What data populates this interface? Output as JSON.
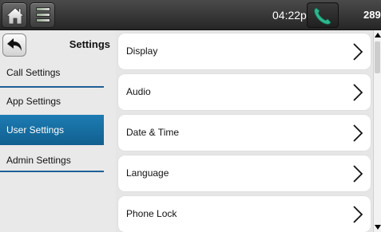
{
  "status_bar": {
    "time": "04:22pm",
    "extension": "289",
    "icons": [
      "home-icon",
      "menu-icon",
      "phone-icon"
    ]
  },
  "sidebar": {
    "title": "Settings",
    "back_icon": "back-arrow-icon",
    "items": [
      {
        "label": "Call Settings",
        "selected": false
      },
      {
        "label": "App Settings",
        "selected": false
      },
      {
        "label": "User Settings",
        "selected": true
      },
      {
        "label": "Admin Settings",
        "selected": false
      }
    ],
    "selected_color": "#1a73a8"
  },
  "settings_list": [
    {
      "label": "Display",
      "icon": "chevron-right-icon"
    },
    {
      "label": "Audio",
      "icon": "chevron-right-icon"
    },
    {
      "label": "Date & Time",
      "icon": "chevron-right-icon"
    },
    {
      "label": "Language",
      "icon": "chevron-right-icon"
    },
    {
      "label": "Phone Lock",
      "icon": "chevron-right-icon"
    }
  ]
}
